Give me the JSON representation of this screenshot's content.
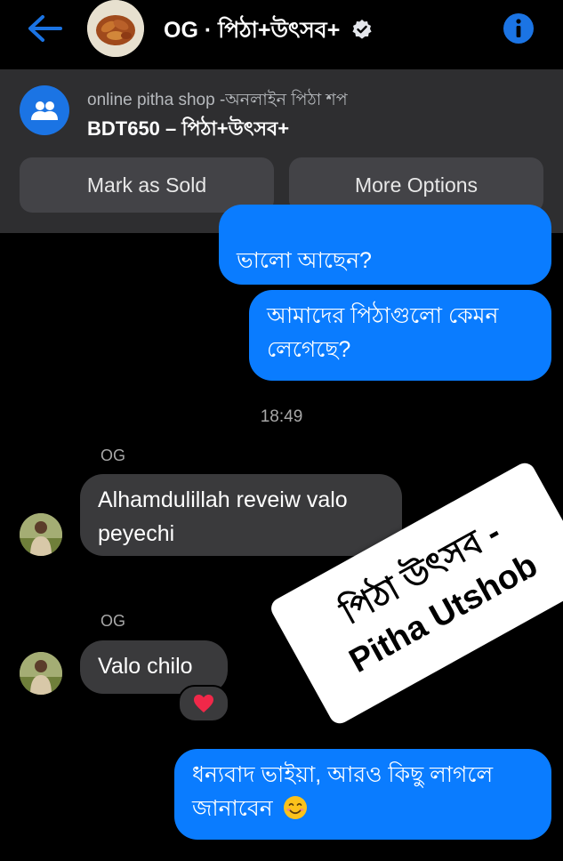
{
  "header": {
    "title": "OG · পিঠা+উৎসব+",
    "back_icon": "back-arrow-icon",
    "info_icon": "info-icon",
    "verified_icon": "verified-badge-icon",
    "accent_color": "#1b74e4"
  },
  "product": {
    "shop_name": "online pitha shop -অনলাইন পিঠা শপ",
    "price_title": "BDT650 – পিঠা+উৎসব+",
    "icon": "group-icon",
    "mark_sold_label": "Mark as Sold",
    "more_options_label": "More Options"
  },
  "messages": {
    "m1": "ভালো আছেন?",
    "m2": "আমাদের পিঠাগুলো কেমন লেগেছে?",
    "timestamp": "18:49",
    "sender1": "OG",
    "m3": "Alhamdulillah reveiw valo peyechi",
    "sender2": "OG",
    "m4": "Valo chilo",
    "reaction_icon": "heart-icon",
    "m5": "ধন্যবাদ ভাইয়া, আরও কিছু লাগলে জানাবেন",
    "m5_emoji": "smiling-face-icon"
  },
  "watermark": {
    "line1": "পিঠা উৎসব -",
    "line2": "Pitha Utshob"
  },
  "colors": {
    "outgoing_bubble": "#0a7cff",
    "incoming_bubble": "#3a3a3c",
    "background": "#000000"
  }
}
